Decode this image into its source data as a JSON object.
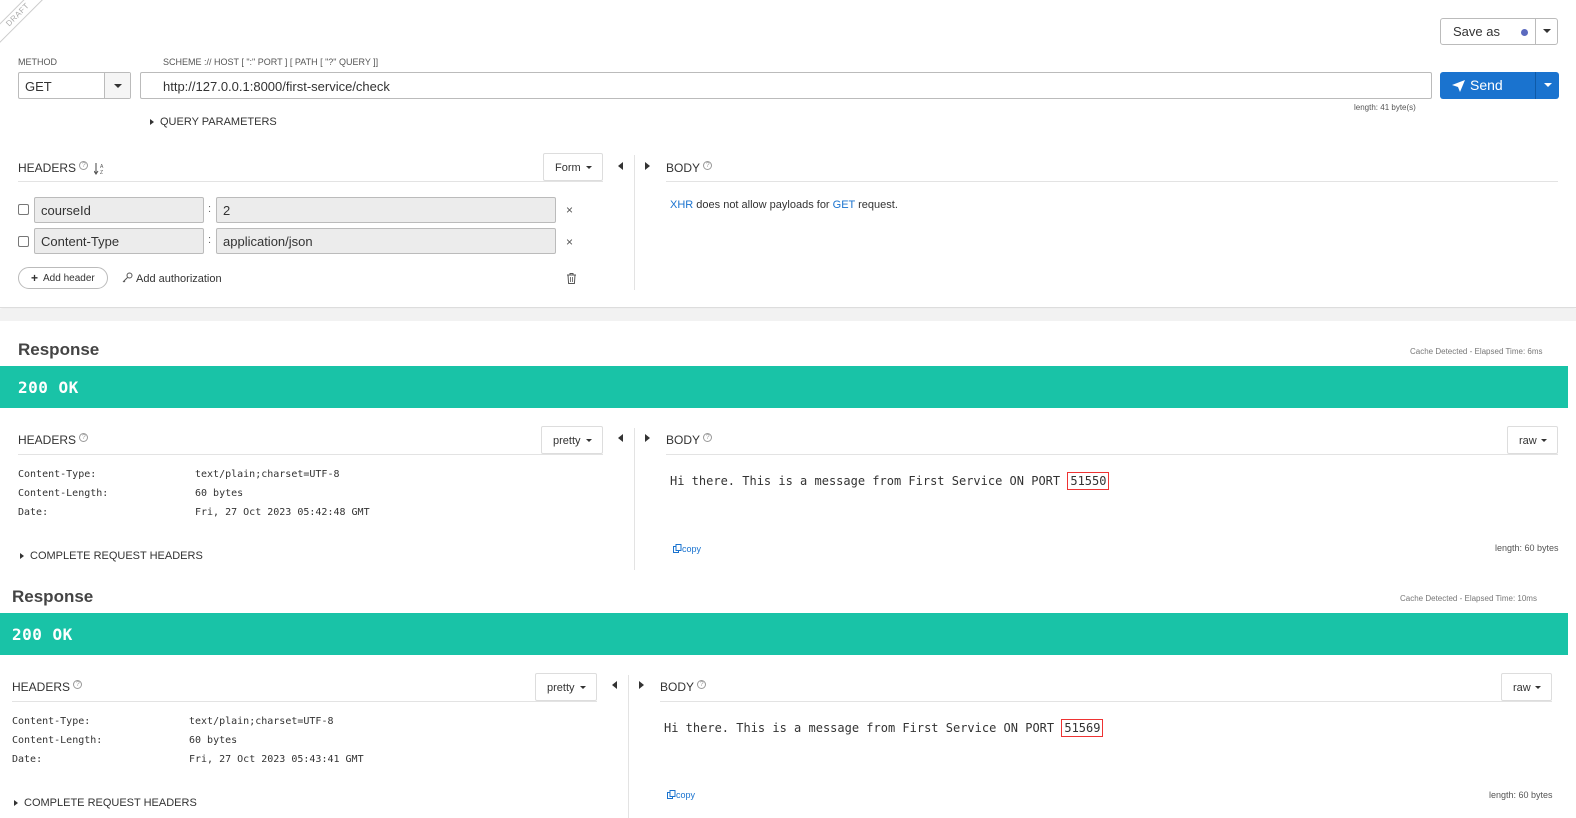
{
  "request": {
    "draft_label": "DRAFT",
    "method_label": "METHOD",
    "method_value": "GET",
    "url_label": "SCHEME :// HOST [ \":\" PORT ] [ PATH [ \"?\" QUERY ]]",
    "url_value": "http://127.0.0.1:8000/first-service/check",
    "length_text": "length: 41 byte(s)",
    "save_as_label": "Save as",
    "send_label": "Send",
    "query_params_label": "QUERY PARAMETERS",
    "headers_label": "HEADERS",
    "headers_mode": "Form",
    "headers": [
      {
        "name": "courseId",
        "value": "2"
      },
      {
        "name": "Content-Type",
        "value": "application/json"
      }
    ],
    "add_header_label": "Add header",
    "add_authorization_label": "Add authorization",
    "body_label": "BODY",
    "body_message": {
      "xhr": "XHR",
      "middle": " does not allow payloads for ",
      "method": "GET",
      "end": " request."
    }
  },
  "responses": [
    {
      "title": "Response",
      "meta": "Cache Detected - Elapsed Time: 6ms",
      "status": "200 OK",
      "headers_label": "HEADERS",
      "headers_mode": "pretty",
      "headers": [
        {
          "key": "Content-Type:",
          "value": "text/plain;charset=UTF-8"
        },
        {
          "key": "Content-Length:",
          "value": "60 bytes"
        },
        {
          "key": "Date:",
          "value": "Fri, 27 Oct 2023 05:42:48 GMT"
        }
      ],
      "complete_headers_label": "COMPLETE REQUEST HEADERS",
      "body_label": "BODY",
      "body_mode": "raw",
      "body_text": "Hi there. This is a message from First Service ON PORT ",
      "body_port": "51550",
      "copy_label": "copy",
      "length_text": "length: 60 bytes"
    },
    {
      "title": "Response",
      "meta": "Cache Detected - Elapsed Time: 10ms",
      "status": "200 OK",
      "headers_label": "HEADERS",
      "headers_mode": "pretty",
      "headers": [
        {
          "key": "Content-Type:",
          "value": "text/plain;charset=UTF-8"
        },
        {
          "key": "Content-Length:",
          "value": "60 bytes"
        },
        {
          "key": "Date:",
          "value": "Fri, 27 Oct 2023 05:43:41 GMT"
        }
      ],
      "complete_headers_label": "COMPLETE REQUEST HEADERS",
      "body_label": "BODY",
      "body_mode": "raw",
      "body_text": "Hi there. This is a message from First Service ON PORT ",
      "body_port": "51569",
      "copy_label": "copy",
      "length_text": "length: 60 bytes"
    }
  ],
  "colors": {
    "accent": "#1a73cf",
    "status_ok": "#19c3a7",
    "highlight": "#ee3333"
  },
  "icons": [
    "send-icon",
    "sort-icon",
    "help-icon",
    "close-icon",
    "trash-icon",
    "plus-icon",
    "key-icon",
    "copy-icon",
    "chevron-down-icon"
  ]
}
